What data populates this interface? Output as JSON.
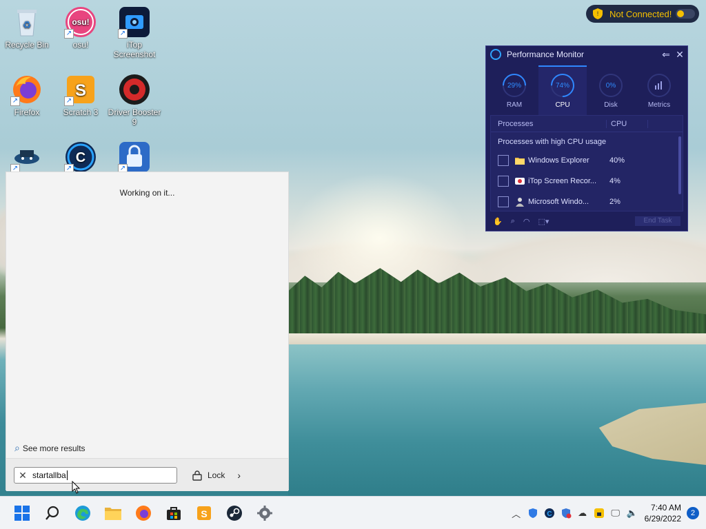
{
  "desktop": {
    "icons": [
      {
        "label": "Recycle Bin",
        "icon": "recycle-bin-icon"
      },
      {
        "label": "osu!",
        "icon": "osu-icon"
      },
      {
        "label": "iTop Screenshot",
        "icon": "itop-screenshot-icon"
      },
      {
        "label": "Firefox",
        "icon": "firefox-icon"
      },
      {
        "label": "Scratch 3",
        "icon": "scratch-icon"
      },
      {
        "label": "Driver Booster 9",
        "icon": "driver-booster-icon"
      },
      {
        "label": "",
        "icon": "game-icon"
      },
      {
        "label": "",
        "icon": "ccleaner-icon"
      },
      {
        "label": "",
        "icon": "vpn-lock-icon"
      }
    ]
  },
  "connection": {
    "status": "Not Connected!",
    "color": "#f5c000"
  },
  "perf_monitor": {
    "title": "Performance Monitor",
    "tabs": [
      {
        "label": "RAM",
        "value": "29%",
        "percent": 29
      },
      {
        "label": "CPU",
        "value": "74%",
        "percent": 74,
        "active": true
      },
      {
        "label": "Disk",
        "value": "0%",
        "percent": 0
      },
      {
        "label": "Metrics",
        "value": "",
        "icon": "bar-chart-icon"
      }
    ],
    "columns": [
      "Processes",
      "CPU"
    ],
    "group_label": "Processes with high CPU usage",
    "rows": [
      {
        "name": "Windows Explorer",
        "cpu": "40%",
        "icon": "folder-icon"
      },
      {
        "name": "iTop Screen Recor...",
        "cpu": "4%",
        "icon": "screen-recorder-icon"
      },
      {
        "name": "Microsoft Windo...",
        "cpu": "2%",
        "icon": "windows-service-icon"
      }
    ],
    "end_task": "End Task"
  },
  "start_search": {
    "status": "Working on it...",
    "see_more": "See more results",
    "query": "startallba",
    "lock_label": "Lock"
  },
  "taskbar": {
    "apps": [
      "start-icon",
      "search-icon",
      "edge-icon",
      "file-explorer-icon",
      "firefox-icon",
      "store-icon",
      "scratch-icon",
      "steam-icon",
      "settings-icon"
    ],
    "time": "7:40 AM",
    "date": "6/29/2022",
    "notifications": "2"
  }
}
